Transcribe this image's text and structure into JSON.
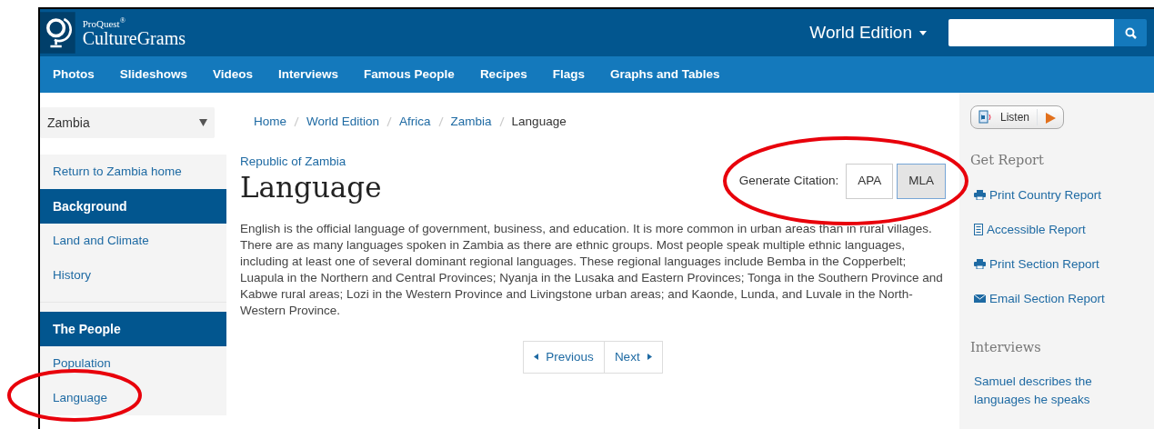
{
  "header": {
    "brand_small": "ProQuest$^{®}$",
    "brand": "CultureGrams",
    "edition": "World Edition"
  },
  "nav": [
    "Photos",
    "Slideshows",
    "Videos",
    "Interviews",
    "Famous People",
    "Recipes",
    "Flags",
    "Graphs and Tables"
  ],
  "sidebar": {
    "country_select": "Zambia",
    "sections": [
      {
        "links": [
          "Return to Zambia home"
        ]
      },
      {
        "heading": "Background",
        "links": [
          "Land and Climate",
          "History"
        ]
      },
      {
        "heading": "The People",
        "links": [
          "Population",
          "Language"
        ]
      }
    ]
  },
  "breadcrumb": [
    "Home",
    "World Edition",
    "Africa",
    "Zambia",
    "Language"
  ],
  "subtitle": "Republic of Zambia",
  "title": "Language",
  "citation": {
    "label": "Generate Citation:",
    "buttons": [
      {
        "label": "APA",
        "selected": false
      },
      {
        "label": "MLA",
        "selected": true
      }
    ]
  },
  "body": "English is the official language of government, business, and education. It is more common in urban areas than in rural villages. There are as many languages spoken in Zambia as there are ethnic groups. Most people speak multiple ethnic languages, including at least one of several dominant regional languages. These regional languages include Bemba in the Copperbelt; Luapula in the Northern and Central Provinces; Nyanja in the Lusaka and Eastern Provinces; Tonga in the Southern Province and Kabwe rural areas; Lozi in the Western Province and Livingstone urban areas; and Kaonde, Lunda, and Luvale in the North-Western Province.",
  "pager": [
    "Previous",
    "Next"
  ],
  "right": {
    "listen": "Listen",
    "report_heading": "Get Report",
    "reports": [
      {
        "kind": "print",
        "label": "Print Country Report"
      },
      {
        "kind": "document",
        "label": "Accessible Report"
      },
      {
        "kind": "print",
        "label": "Print Section Report"
      },
      {
        "kind": "email",
        "label": "Email Section Report"
      }
    ],
    "interviews_heading": "Interviews",
    "interviews": [
      "Samuel describes the languages he speaks"
    ]
  }
}
